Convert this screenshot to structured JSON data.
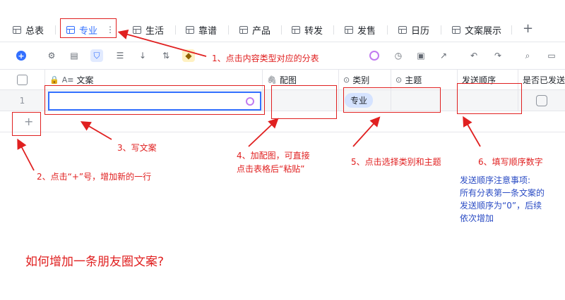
{
  "tabs": [
    {
      "label": "总表",
      "active": false
    },
    {
      "label": "专业",
      "active": true
    },
    {
      "label": "生活",
      "active": false
    },
    {
      "label": "靠谱",
      "active": false
    },
    {
      "label": "产品",
      "active": false
    },
    {
      "label": "转发",
      "active": false
    },
    {
      "label": "发售",
      "active": false
    },
    {
      "label": "日历",
      "active": false
    },
    {
      "label": "文案展示",
      "active": false
    }
  ],
  "add_tab_label": "+",
  "columns": [
    "文案",
    "配图",
    "类别",
    "主题",
    "发送顺序",
    "是否已发送"
  ],
  "rows": [
    {
      "num": "1",
      "category": "专业"
    }
  ],
  "add_row_label": "+",
  "annotations": {
    "step1": "1、点击内容类型对应的分表",
    "step2": "2、点击“+”号，增加新的一行",
    "step3": "3、写文案",
    "step4_line1": "4、加配图，可直接",
    "step4_line2": "点击表格后“粘贴”",
    "step5": "5、点击选择类别和主题",
    "step6": "6、填写顺序数字"
  },
  "note_lines": [
    "发送顺序注意事项:",
    "所有分表第一条文案的",
    "发送顺序为“0”，后续",
    "依次增加"
  ],
  "title": "如何增加一条朋友圈文案?",
  "colors": {
    "accent": "#3370ff",
    "annotation": "#e02020",
    "note": "#2b4cc4"
  }
}
